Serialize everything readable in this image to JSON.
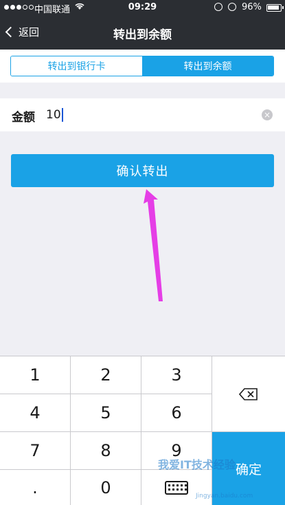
{
  "status_bar": {
    "carrier": "中国联通",
    "time": "09:29",
    "battery": "96%"
  },
  "nav": {
    "back_label": "返回",
    "title": "转出到余额"
  },
  "tabs": [
    {
      "label": "转出到银行卡",
      "selected": false
    },
    {
      "label": "转出到余额",
      "selected": true
    }
  ],
  "amount": {
    "label": "金额",
    "value": "10"
  },
  "confirm_button": {
    "label": "确认转出"
  },
  "keypad": {
    "keys": [
      "1",
      "2",
      "3",
      "4",
      "5",
      "6",
      "7",
      "8",
      "9",
      ".",
      "0"
    ],
    "ok_label": "确定"
  },
  "watermark": {
    "text": "我爱IT技术经验",
    "url": "Jingyan.baidu.com"
  },
  "colors": {
    "accent": "#1aa2e6",
    "nav_background": "#2b2e33",
    "annotation_arrow": "#e53ee6"
  }
}
